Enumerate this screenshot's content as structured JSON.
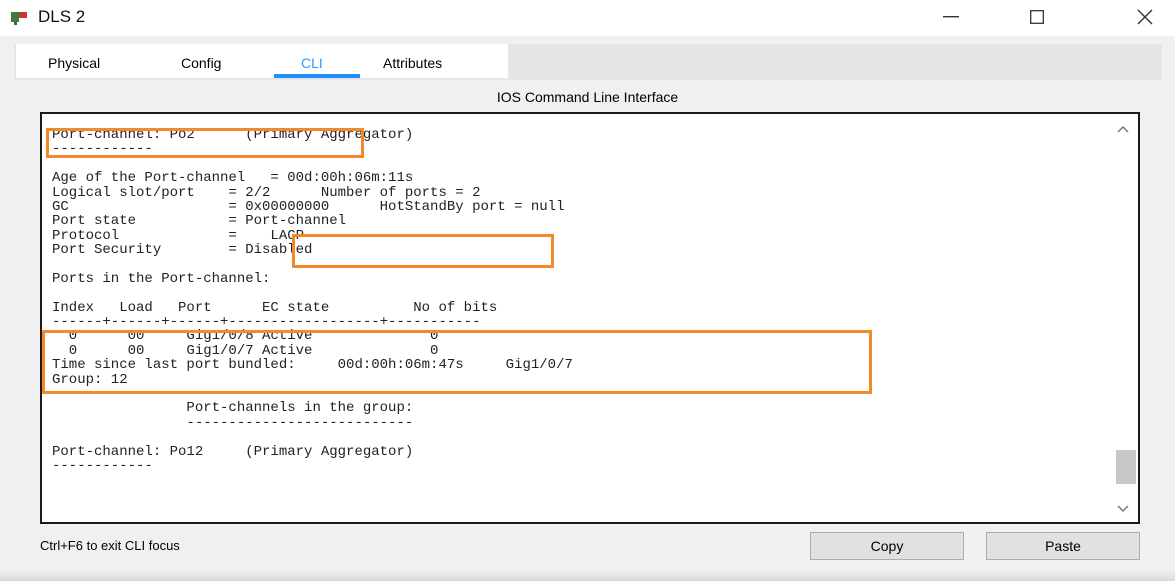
{
  "window": {
    "title": "DLS 2",
    "controls": {
      "minimize": "—",
      "maximize": "☐",
      "close": "✕"
    }
  },
  "tabs": [
    {
      "label": "Physical",
      "active": false
    },
    {
      "label": "Config",
      "active": false
    },
    {
      "label": "CLI",
      "active": true
    },
    {
      "label": "Attributes",
      "active": false
    }
  ],
  "panel": {
    "title": "IOS Command Line Interface"
  },
  "terminal": {
    "lines": [
      "Port-channel: Po2      (Primary Aggregator)",
      "------------",
      "",
      "Age of the Port-channel   = 00d:00h:06m:11s",
      "Logical slot/port    = 2/2      Number of ports = 2",
      "GC                   = 0x00000000      HotStandBy port = null",
      "Port state           = Port-channel",
      "Protocol             =    LACP",
      "Port Security        = Disabled",
      "",
      "Ports in the Port-channel:",
      "",
      "Index   Load   Port      EC state          No of bits",
      "------+------+------+------------------+-----------",
      "  0      00     Gig1/0/8 Active              0",
      "  0      00     Gig1/0/7 Active              0",
      "Time since last port bundled:     00d:00h:06m:47s     Gig1/0/7",
      "Group: 12",
      "----------",
      "                Port-channels in the group:",
      "                ---------------------------",
      "",
      "Port-channel: Po12     (Primary Aggregator)",
      "------------"
    ],
    "highlight_color": "#f08a2b"
  },
  "footer": {
    "hint": "Ctrl+F6 to exit CLI focus",
    "copy_label": "Copy",
    "paste_label": "Paste"
  },
  "icons": {
    "app": "packet-tracer-device-icon",
    "scroll_up": "chevron-up-icon",
    "scroll_down": "chevron-down-icon"
  },
  "colors": {
    "active_tab": "#3399ff",
    "highlight": "#f08a2b"
  }
}
